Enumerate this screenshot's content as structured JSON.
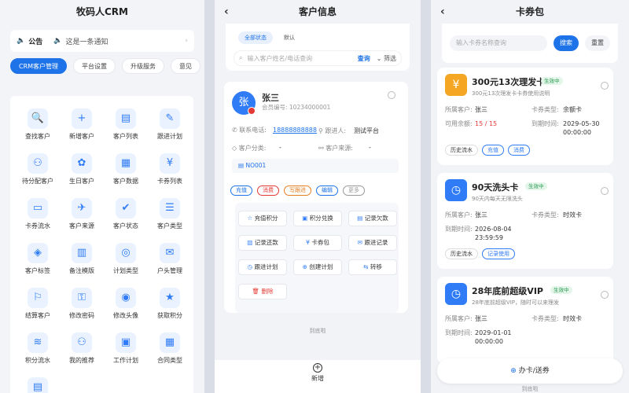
{
  "panel1": {
    "title": "牧码人CRM",
    "notice": {
      "label": "公告",
      "text": "这是一条通知"
    },
    "tabs": [
      "CRM客户管理",
      "平台设置",
      "升级服务",
      "意见"
    ],
    "grid": [
      {
        "label": "查找客户",
        "icon": "🔍"
      },
      {
        "label": "新增客户",
        "icon": "+"
      },
      {
        "label": "客户列表",
        "icon": "▤"
      },
      {
        "label": "跟进计划",
        "icon": "✎"
      },
      {
        "label": "待分配客户",
        "icon": "⚇"
      },
      {
        "label": "生日客户",
        "icon": "✿"
      },
      {
        "label": "客户数据",
        "icon": "▦"
      },
      {
        "label": "卡券列表",
        "icon": "¥"
      },
      {
        "label": "卡券流水",
        "icon": "▭"
      },
      {
        "label": "客户来源",
        "icon": "✈"
      },
      {
        "label": "客户状态",
        "icon": "✔"
      },
      {
        "label": "客户类型",
        "icon": "☰"
      },
      {
        "label": "客户标签",
        "icon": "◈"
      },
      {
        "label": "备注模版",
        "icon": "▥"
      },
      {
        "label": "计划类型",
        "icon": "◎"
      },
      {
        "label": "户头管理",
        "icon": "✉"
      },
      {
        "label": "结算客户",
        "icon": "⚐"
      },
      {
        "label": "修改密码",
        "icon": "⚿"
      },
      {
        "label": "修改头像",
        "icon": "◉"
      },
      {
        "label": "获取积分",
        "icon": "★"
      },
      {
        "label": "积分流水",
        "icon": "≋"
      },
      {
        "label": "我的推荐",
        "icon": "⚇"
      },
      {
        "label": "工作计划",
        "icon": "▣"
      },
      {
        "label": "合同类型",
        "icon": "▦"
      },
      {
        "label": "",
        "icon": "▤"
      }
    ]
  },
  "panel2": {
    "title": "客户信息",
    "pills": [
      "全部状态",
      "默认"
    ],
    "search": {
      "placeholder": "输入客户姓名/电话查询",
      "query": "查询",
      "filter": "筛选"
    },
    "customer": {
      "avatar": "张",
      "name": "张三",
      "number": "会员编号: 10234000001",
      "phone_label": "联系电话:",
      "phone": "18888888888",
      "follower_label": "跟进人:",
      "follower": "测试平台",
      "cat_label": "客户分类:",
      "cat": "-",
      "src_label": "客户来源:",
      "src": "-",
      "note": "NO001"
    },
    "tags": [
      {
        "t": "充值",
        "c": "#1e73e8"
      },
      {
        "t": "消费",
        "c": "#e53935"
      },
      {
        "t": "写跟进",
        "c": "#e67e22"
      },
      {
        "t": "编辑",
        "c": "#1e73e8"
      },
      {
        "t": "更多",
        "c": "#999999"
      }
    ],
    "actions": [
      {
        "t": "充值积分",
        "i": "☆"
      },
      {
        "t": "积分兑换",
        "i": "▣"
      },
      {
        "t": "记录欠款",
        "i": "▤"
      },
      {
        "t": "记录还款",
        "i": "▥"
      },
      {
        "t": "卡券包",
        "i": "¥"
      },
      {
        "t": "跟进记录",
        "i": "✉"
      },
      {
        "t": "跟进计划",
        "i": "◷"
      },
      {
        "t": "创建计划",
        "i": "⊕"
      },
      {
        "t": "转移",
        "i": "⇆"
      },
      {
        "t": "删除",
        "i": "🗑"
      }
    ],
    "footer": "到底啦",
    "add": "新增"
  },
  "panel3": {
    "title": "卡券包",
    "search": {
      "placeholder": "输入卡券名称查询",
      "btn": "搜索",
      "reset": "重置"
    },
    "cards": [
      {
        "icon": "¥",
        "color": "#f5a623",
        "name": "300元13次理发卡",
        "status": "生效中",
        "sub": "300元13次理发卡卡券使用说明",
        "rows": [
          [
            "所属客户:",
            "张三",
            "卡券类型:",
            "余额卡"
          ],
          [
            "可用余额:",
            "15 / 15",
            "到期时间:",
            "2029-05-30 00:00:00"
          ]
        ],
        "btns": [
          "历史流水",
          "充值",
          "消费"
        ]
      },
      {
        "icon": "◷",
        "color": "#2f7cf6",
        "name": "90天洗头卡",
        "status": "生效中",
        "sub": "90天内每天无限洗头",
        "rows": [
          [
            "所属客户:",
            "张三",
            "卡券类型:",
            "时效卡"
          ],
          [
            "到期时间:",
            "2026-08-04 23:59:59",
            "",
            ""
          ]
        ],
        "btns": [
          "历史流水",
          "记录使用"
        ]
      },
      {
        "icon": "◷",
        "color": "#2f7cf6",
        "name": "28年底前超级VIP",
        "status": "生效中",
        "sub": "28年底前超级VIP，随时可以来理发",
        "rows": [
          [
            "所属客户:",
            "张三",
            "卡券类型:",
            "时效卡"
          ],
          [
            "到期时间:",
            "2029-01-01 00:00:00",
            "",
            ""
          ]
        ],
        "btns": []
      }
    ],
    "issue": "办卡/送券",
    "footer": "到底啦"
  }
}
